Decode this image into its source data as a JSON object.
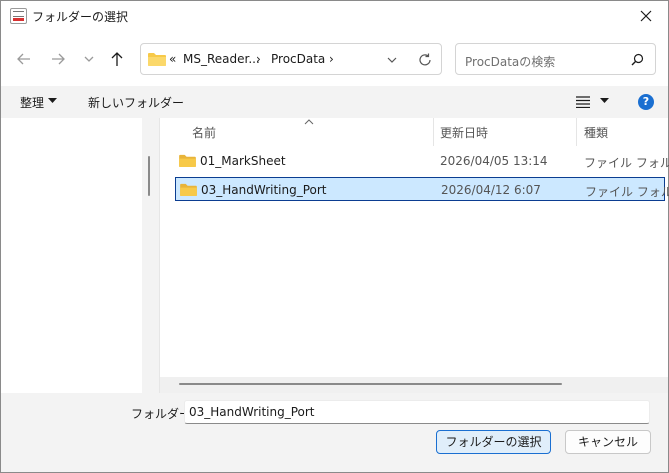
{
  "window": {
    "title": "フォルダーの選択",
    "app_icon": "app-icon",
    "close_icon": "close-icon"
  },
  "nav": {
    "back_icon": "back-arrow-icon",
    "forward_icon": "forward-arrow-icon",
    "recent_icon": "chevron-down-icon",
    "up_icon": "up-arrow-icon",
    "address": {
      "overflow": "«",
      "segments": [
        "MS_Reader...",
        "ProcData"
      ],
      "separator": "›",
      "dropdown_icon": "chevron-down-icon",
      "refresh_icon": "refresh-icon"
    },
    "search": {
      "placeholder": "ProcDataの検索",
      "icon": "search-icon"
    }
  },
  "toolbar": {
    "organize_label": "整理",
    "new_folder_label": "新しいフォルダー",
    "view_icon": "view-list-icon",
    "help_label": "?"
  },
  "file_list": {
    "columns": [
      "名前",
      "更新日時",
      "種類"
    ],
    "sort_column": "名前",
    "rows": [
      {
        "name": "01_MarkSheet",
        "modified": "2026/04/05 13:14",
        "type": "ファイル フォルダー",
        "selected": false
      },
      {
        "name": "03_HandWriting_Port",
        "modified": "2026/04/12 6:07",
        "type": "ファイル フォルダー",
        "selected": true
      }
    ]
  },
  "footer": {
    "folder_label": "フォルダー:",
    "folder_value": "03_HandWriting_Port",
    "select_button": "フォルダーの選択",
    "cancel_button": "キャンセル"
  },
  "colors": {
    "accent": "#1a6fd1",
    "selection_fill": "#cce8ff",
    "folder_yellow": "#f7c948"
  }
}
